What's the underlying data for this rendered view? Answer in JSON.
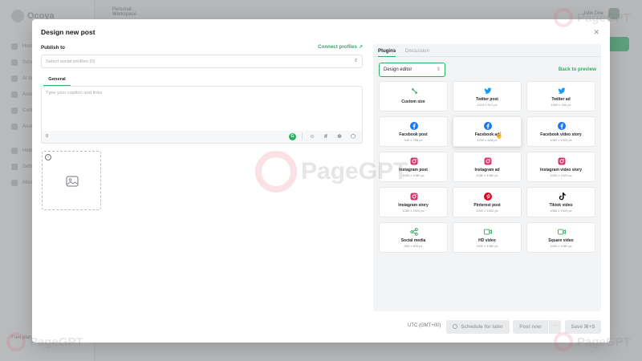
{
  "background": {
    "logo": "Ocoya",
    "workspace": "Personal",
    "workspace_sub": "Workspace",
    "user": "John Doe",
    "nav": [
      "Home",
      "Scheduler",
      "AI tools",
      "Automations",
      "Content",
      "Analytics",
      "Help",
      "Settings",
      "More"
    ],
    "bottom_user": "Free plan"
  },
  "modal": {
    "title": "Design new post",
    "close": "✕",
    "publish_label": "Publish to",
    "connect_link": "Connect profiles",
    "profiles_placeholder": "Select social profiles (0)",
    "tab_general": "General",
    "caption_placeholder": "Type your caption and links",
    "char_count": "0"
  },
  "panel": {
    "tabs": [
      "Plugins",
      "Discussion"
    ],
    "design_select": "Design editor",
    "back_link": "Back to preview",
    "cards": [
      {
        "name": "Custom size",
        "size": "",
        "icon": "resize-icon",
        "color": "#2fae63"
      },
      {
        "name": "Twitter post",
        "size": "1024 x 512 px",
        "icon": "twitter-icon",
        "color": "#1d9bf0"
      },
      {
        "name": "Twitter ad",
        "size": "1600 x 400 px",
        "icon": "twitter-icon",
        "color": "#1d9bf0"
      },
      {
        "name": "Facebook post",
        "size": "940 x 788 px",
        "icon": "facebook-icon",
        "color": "#1877f2"
      },
      {
        "name": "Facebook ad",
        "size": "1200 x 628 px",
        "icon": "facebook-icon",
        "color": "#1877f2"
      },
      {
        "name": "Facebook video story",
        "size": "1080 x 1920 px",
        "icon": "facebook-icon",
        "color": "#1877f2"
      },
      {
        "name": "Instagram post",
        "size": "1080 x 1080 px",
        "icon": "instagram-icon",
        "color": "#e1306c"
      },
      {
        "name": "Instagram ad",
        "size": "1080 x 1080 px",
        "icon": "instagram-icon",
        "color": "#e1306c"
      },
      {
        "name": "Instagram video story",
        "size": "1080 x 1920 px",
        "icon": "instagram-icon",
        "color": "#e1306c"
      },
      {
        "name": "Instagram story",
        "size": "1080 x 1920 px",
        "icon": "instagram-icon",
        "color": "#e1306c"
      },
      {
        "name": "Pinterest post",
        "size": "1000 x 1500 px",
        "icon": "pinterest-icon",
        "color": "#e60023"
      },
      {
        "name": "Tiktok video",
        "size": "1080 x 1920 px",
        "icon": "tiktok-icon",
        "color": "#111111"
      },
      {
        "name": "Social media",
        "size": "800 x 800 px",
        "icon": "share-icon",
        "color": "#2fae63"
      },
      {
        "name": "HD video",
        "size": "1920 x 1080 px",
        "icon": "video-icon",
        "color": "#2fae63"
      },
      {
        "name": "Square video",
        "size": "1080 x 1080 px",
        "icon": "video-icon",
        "color": "#2fae63"
      }
    ]
  },
  "footer": {
    "timezone": "UTC (GMT+00)",
    "schedule": "Schedule for later",
    "post_now": "Post now",
    "more": "···",
    "save": "Save ⌘+S"
  },
  "watermark": "PageGPT",
  "colors": {
    "accent": "#2fae63",
    "overlay": "#1e2126"
  }
}
